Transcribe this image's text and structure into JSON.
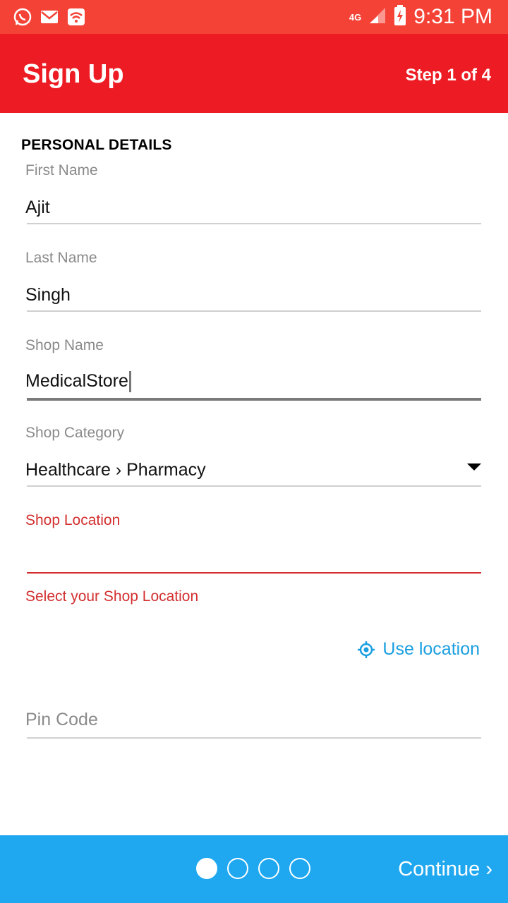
{
  "status_bar": {
    "time": "9:31 PM",
    "network": "4G",
    "icons": [
      "whatsapp-icon",
      "mail-icon",
      "wifi-notification-icon",
      "signal-icon",
      "battery-charging-icon"
    ]
  },
  "app_bar": {
    "title": "Sign Up",
    "step": "Step 1 of 4"
  },
  "form": {
    "section_title": "PERSONAL DETAILS",
    "first_name": {
      "label": "First Name",
      "value": "Ajit"
    },
    "last_name": {
      "label": "Last Name",
      "value": "Singh"
    },
    "shop_name": {
      "label": "Shop Name",
      "value": "MedicalStore"
    },
    "shop_category": {
      "label": "Shop Category",
      "value": "Healthcare › Pharmacy"
    },
    "shop_location": {
      "label": "Shop Location",
      "value": "",
      "error": "Select your Shop Location"
    },
    "use_location_label": "Use location",
    "pin_code": {
      "placeholder": "Pin Code",
      "value": ""
    }
  },
  "bottom_bar": {
    "continue_label": "Continue ›",
    "steps_total": 4,
    "current_step": 1
  },
  "colors": {
    "status_bar": "#F44336",
    "app_bar": "#ED1C24",
    "bottom_bar": "#1FA8F0",
    "error": "#D32F2F",
    "link": "#1A9FE0"
  }
}
